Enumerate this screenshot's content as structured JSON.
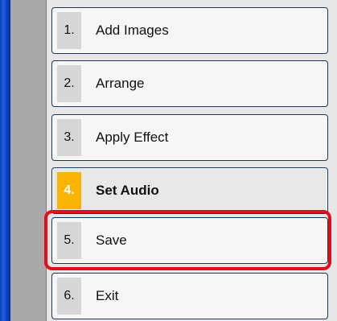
{
  "colors": {
    "accent": "#f8b400",
    "highlight": "#e0101a",
    "button_border": "#17345d"
  },
  "steps": [
    {
      "number": "1.",
      "label": "Add Images"
    },
    {
      "number": "2.",
      "label": "Arrange"
    },
    {
      "number": "3.",
      "label": "Apply Effect"
    },
    {
      "number": "4.",
      "label": "Set Audio",
      "active": true
    },
    {
      "number": "5.",
      "label": "Save",
      "highlighted": true
    },
    {
      "number": "6.",
      "label": "Exit"
    }
  ]
}
